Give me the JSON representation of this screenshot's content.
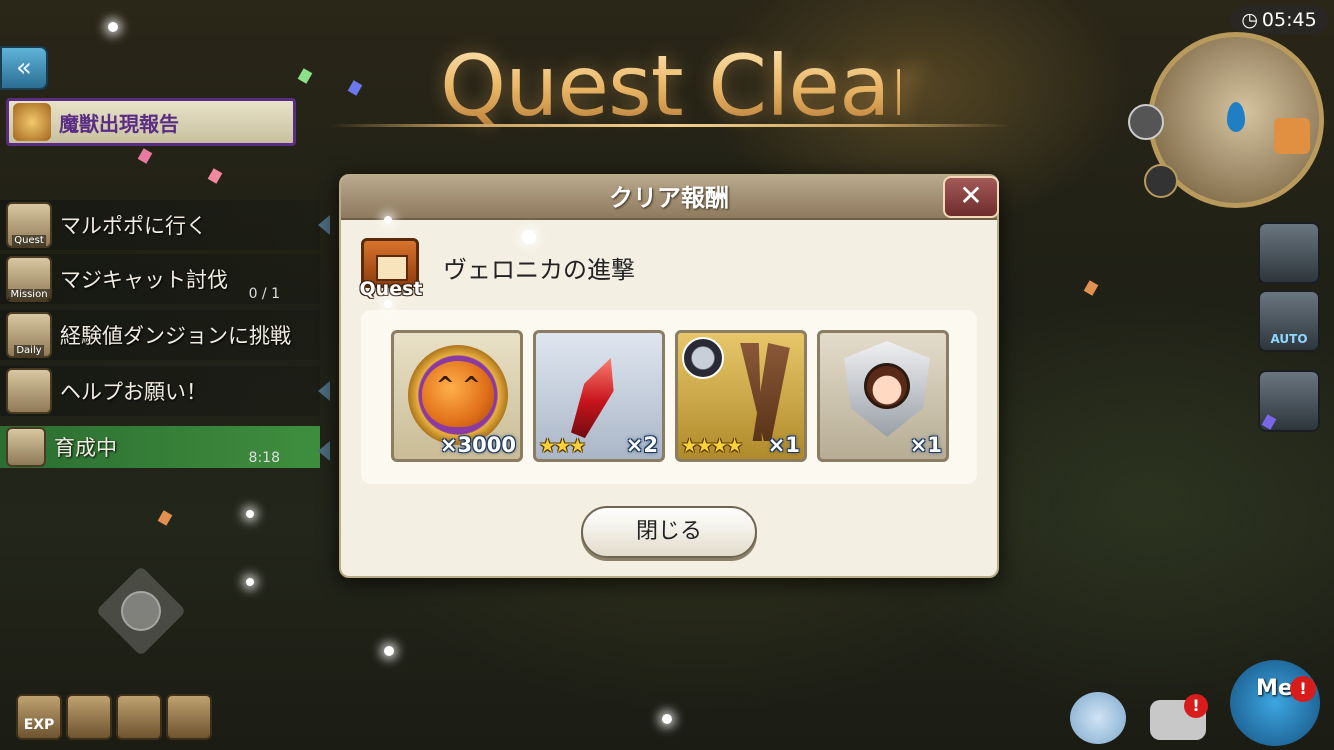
{
  "header": {
    "title": "Quest Clear",
    "time": "05:45"
  },
  "left_panel": {
    "back_label": "«",
    "notice": "魔獣出現報告",
    "quests": [
      {
        "icon_label": "Quest",
        "label": "マルポポに行く",
        "count": ""
      },
      {
        "icon_label": "Mission",
        "label": "マジキャット討伐",
        "count": "0 / 1"
      },
      {
        "icon_label": "Daily",
        "label": "経験値ダンジョンに挑戦",
        "count": ""
      },
      {
        "icon_label": "",
        "label": "ヘルプお願い！",
        "count": ""
      },
      {
        "icon_label": "",
        "label": "育成中",
        "count": "8:18"
      }
    ]
  },
  "bottom_left": {
    "exp_label": "EXP"
  },
  "side_buttons": {
    "auto_label": "AUTO"
  },
  "bottom_right": {
    "me_label": "Me"
  },
  "dialog": {
    "title": "クリア報酬",
    "close_x": "✕",
    "quest_badge": "Quest",
    "quest_name": "ヴェロニカの進撃",
    "rewards": [
      {
        "icon": "pumpkin-coin-icon",
        "stars": "",
        "qty": "×3000"
      },
      {
        "icon": "red-crystal-icon",
        "stars": "★★★",
        "qty": "×2"
      },
      {
        "icon": "boots-equipment-icon",
        "stars": "★★★★",
        "qty": "×1"
      },
      {
        "icon": "character-emblem-icon",
        "stars": "",
        "qty": "×1"
      }
    ],
    "close_button": "閉じる"
  }
}
